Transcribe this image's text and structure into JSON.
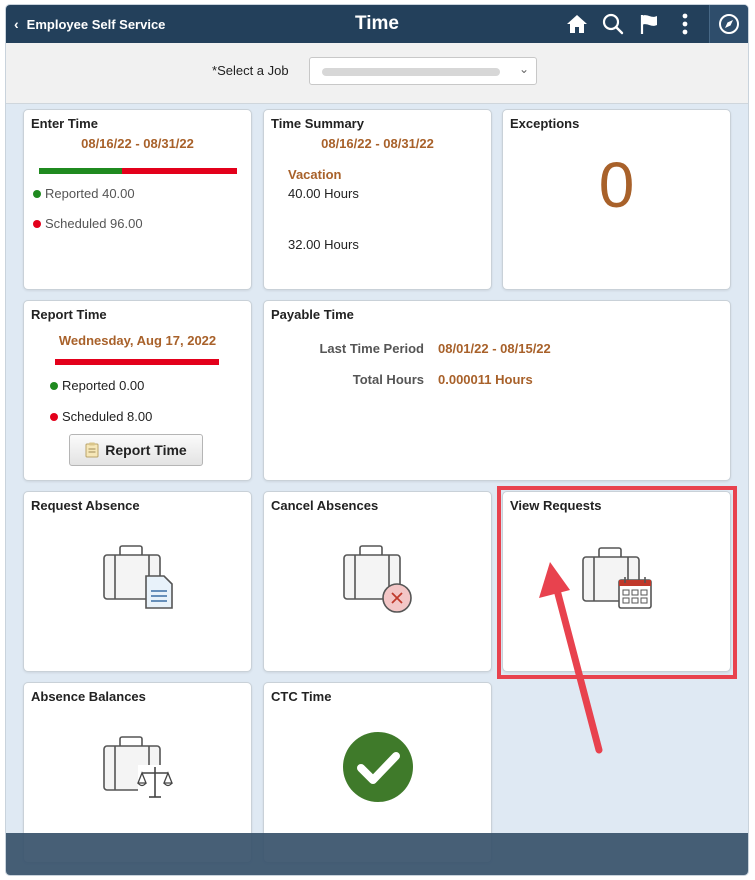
{
  "header": {
    "back_label": "Employee Self Service",
    "title": "Time",
    "icons": [
      "home-icon",
      "search-icon",
      "flag-icon",
      "more-vert-icon",
      "compass-icon"
    ]
  },
  "job_select": {
    "label": "Select a Job",
    "required_mark": "*"
  },
  "tiles": {
    "enter_time": {
      "title": "Enter Time",
      "period": "08/16/22 - 08/31/22",
      "reported": "Reported 40.00",
      "scheduled": "Scheduled 96.00",
      "reported_fraction": 0.42
    },
    "time_summary": {
      "title": "Time Summary",
      "period": "08/16/22 - 08/31/22",
      "category": "Vacation",
      "hours_1": "40.00 Hours",
      "hours_2": "32.00 Hours"
    },
    "exceptions": {
      "title": "Exceptions",
      "count": "0"
    },
    "report_time": {
      "title": "Report Time",
      "date": "Wednesday, Aug 17, 2022",
      "reported": "Reported 0.00",
      "scheduled": "Scheduled 8.00",
      "button_label": "Report Time",
      "reported_fraction": 0
    },
    "payable_time": {
      "title": "Payable Time",
      "last_period_label": "Last Time Period",
      "last_period_value": "08/01/22 - 08/15/22",
      "total_hours_label": "Total Hours",
      "total_hours_value": "0.000011 Hours"
    },
    "request_absence": {
      "title": "Request Absence",
      "icon": "briefcase-document-icon"
    },
    "cancel_absences": {
      "title": "Cancel Absences",
      "icon": "briefcase-cancel-icon"
    },
    "view_requests": {
      "title": "View Requests",
      "icon": "briefcase-calendar-icon"
    },
    "absence_balances": {
      "title": "Absence Balances",
      "icon": "briefcase-scale-icon"
    },
    "ctc_time": {
      "title": "CTC Time",
      "icon": "check-circle-icon"
    }
  },
  "colors": {
    "header_bg": "#23405b",
    "accent_orange": "#a8612a",
    "reported_green": "#1f8a1f",
    "scheduled_red": "#e3001b",
    "check_green": "#3f7a2a",
    "highlight_red": "#e8424e"
  }
}
